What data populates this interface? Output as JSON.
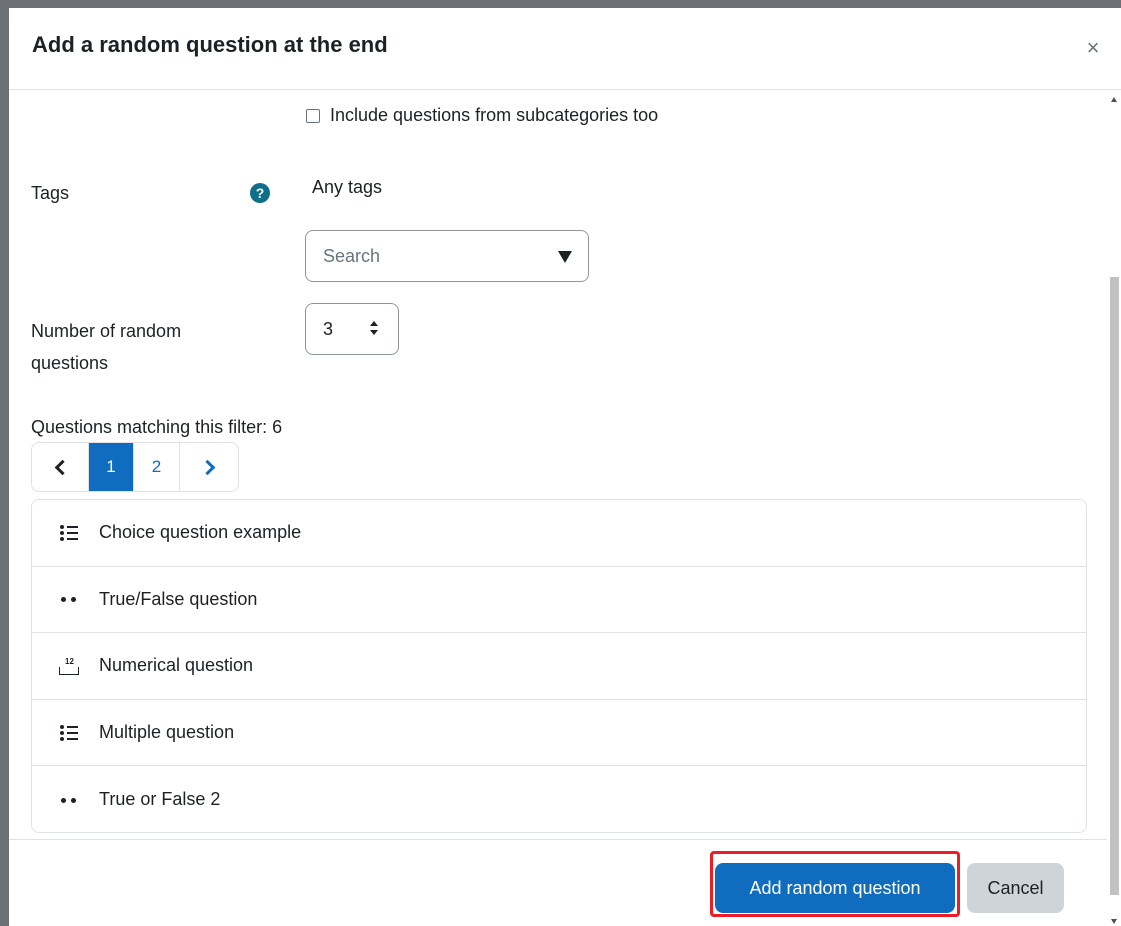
{
  "modal": {
    "title": "Add a random question at the end",
    "close_label": "×"
  },
  "form": {
    "include_subcategories_label": "Include questions from subcategories too",
    "include_subcategories_checked": false,
    "tags_label": "Tags",
    "help_icon": "question-circle-icon",
    "tags_value": "Any tags",
    "tags_search_placeholder": "Search",
    "num_random_label": "Number of random questions",
    "num_random_value": "3",
    "matching_text": "Questions matching this filter: 6"
  },
  "pagination": {
    "pages": [
      "1",
      "2"
    ],
    "current": "1"
  },
  "questions": [
    {
      "name": "Choice question example",
      "icon": "multichoice-icon"
    },
    {
      "name": "True/False question",
      "icon": "truefalse-icon"
    },
    {
      "name": "Numerical question",
      "icon": "numerical-icon"
    },
    {
      "name": "Multiple question",
      "icon": "multichoice-icon"
    },
    {
      "name": "True or False 2",
      "icon": "truefalse-icon"
    }
  ],
  "footer": {
    "add_label": "Add random question",
    "cancel_label": "Cancel",
    "highlight_color": "#ee1c24",
    "primary_color": "#0f6cbf"
  }
}
